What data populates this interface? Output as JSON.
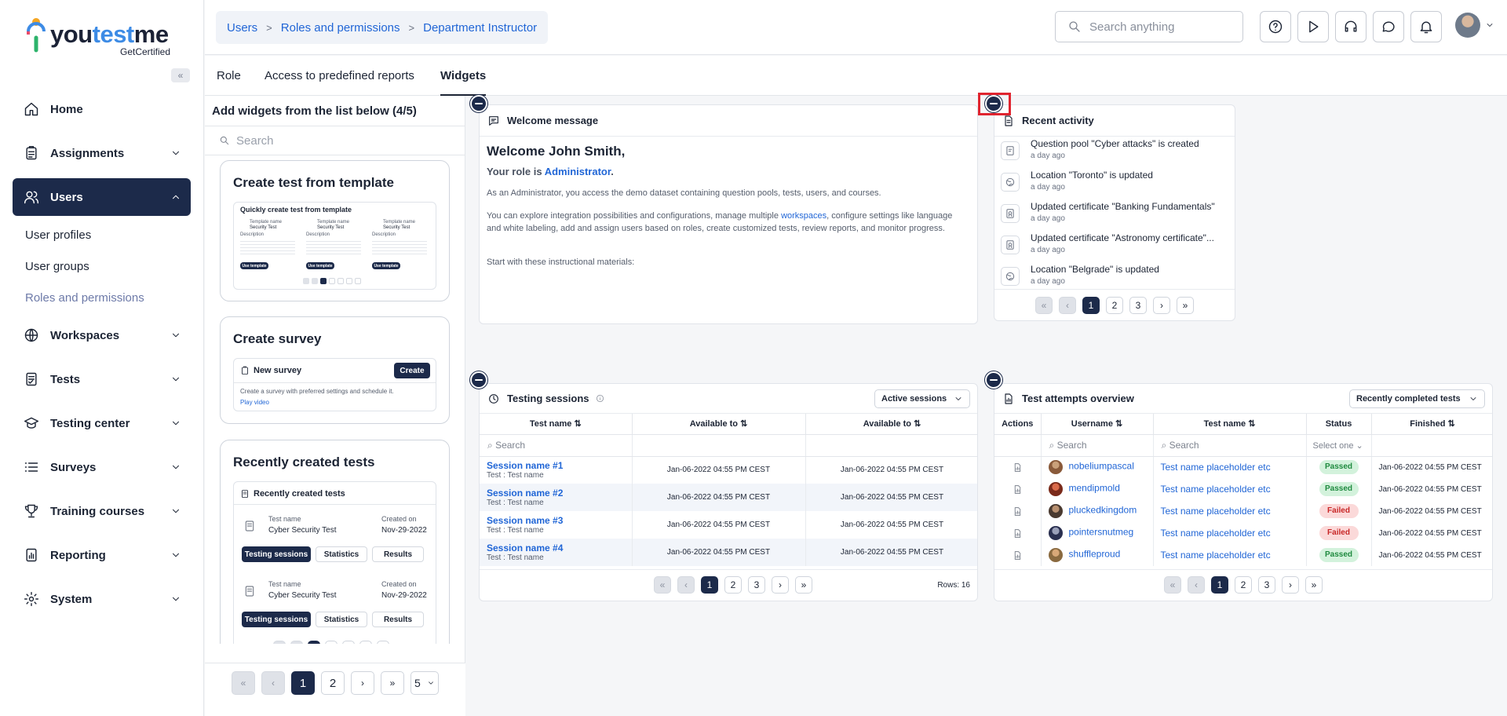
{
  "brand": {
    "name_a": "you",
    "name_b": "test",
    "name_c": "me",
    "tagline": "GetCertified"
  },
  "sidebar": {
    "items": [
      {
        "label": "Home",
        "icon": "home-icon"
      },
      {
        "label": "Assignments",
        "icon": "clipboard-icon"
      },
      {
        "label": "Users",
        "icon": "users-icon"
      },
      {
        "label": "Workspaces",
        "icon": "globe-icon"
      },
      {
        "label": "Tests",
        "icon": "test-icon"
      },
      {
        "label": "Testing center",
        "icon": "graduation-icon"
      },
      {
        "label": "Surveys",
        "icon": "list-icon"
      },
      {
        "label": "Training courses",
        "icon": "trophy-icon"
      },
      {
        "label": "Reporting",
        "icon": "report-icon"
      },
      {
        "label": "System",
        "icon": "gear-icon"
      }
    ],
    "users_sub": [
      "User profiles",
      "User groups",
      "Roles and permissions"
    ]
  },
  "breadcrumb": [
    "Users",
    "Roles and permissions",
    "Department Instructor"
  ],
  "search": {
    "placeholder": "Search anything"
  },
  "tabs": [
    "Role",
    "Access to predefined reports",
    "Widgets"
  ],
  "panel": {
    "title": "Add widgets from the list below (4/5)",
    "search_placeholder": "Search",
    "cards": {
      "template": {
        "title": "Create test from template",
        "inner_title": "Quickly create test from template",
        "col_label": "Template name",
        "col_value": "Security Test",
        "desc": "Description",
        "btn": "Use template"
      },
      "survey": {
        "title": "Create survey",
        "inner_title": "New survey",
        "btn": "Create",
        "desc": "Create a survey with preferred settings and schedule it.",
        "link": "Play video"
      },
      "recent": {
        "title": "Recently created tests",
        "inner_title": "Recently created tests",
        "rows": [
          {
            "name_label": "Test name",
            "name": "Cyber Security Test",
            "created_label": "Created on",
            "created": "Nov-29-2022"
          },
          {
            "name_label": "Test name",
            "name": "Cyber Security Test",
            "created_label": "Created on",
            "created": "Nov-29-2022"
          }
        ],
        "buttons": [
          "Testing sessions",
          "Statistics",
          "Results"
        ]
      }
    },
    "pager": {
      "pages": [
        "1",
        "2"
      ],
      "per_page": "5"
    }
  },
  "welcome": {
    "title": "Welcome message",
    "greeting": "Welcome John Smith,",
    "role_prefix": "Your role is ",
    "role": "Administrator",
    "p1": "As an Administrator, you access the demo dataset containing question pools, tests, users, and courses.",
    "p2a": "You can explore integration possibilities and configurations, manage multiple ",
    "p2link": "workspaces",
    "p2b": ", configure settings like language and white labeling, add and assign users based on roles, create customized tests, review reports, and monitor progress.",
    "p3": "Start with these instructional materials:"
  },
  "activity": {
    "title": "Recent activity",
    "items": [
      {
        "text": "Question pool \"Cyber attacks\" is created",
        "time": "a day ago",
        "icon": "question-pool-icon"
      },
      {
        "text": "Location \"Toronto\" is updated",
        "time": "a day ago",
        "icon": "location-icon"
      },
      {
        "text": "Updated certificate \"Banking Fundamentals\"",
        "time": "a day ago",
        "icon": "certificate-icon"
      },
      {
        "text": "Updated certificate \"Astronomy certificate\"...",
        "time": "a day ago",
        "icon": "certificate-icon"
      },
      {
        "text": "Location \"Belgrade\" is updated",
        "time": "a day ago",
        "icon": "location-icon"
      }
    ],
    "pages": [
      "1",
      "2",
      "3"
    ]
  },
  "sessions": {
    "title": "Testing sessions",
    "dropdown": "Active sessions",
    "columns": [
      "Test name",
      "Available to",
      "Available to"
    ],
    "search_placeholder": "Search",
    "rows": [
      {
        "name": "Session name #1",
        "sub": "Test : Test name",
        "a": "Jan-06-2022 04:55 PM CEST",
        "b": "Jan-06-2022 04:55 PM CEST"
      },
      {
        "name": "Session name #2",
        "sub": "Test : Test name",
        "a": "Jan-06-2022 04:55 PM CEST",
        "b": "Jan-06-2022 04:55 PM CEST"
      },
      {
        "name": "Session name #3",
        "sub": "Test : Test name",
        "a": "Jan-06-2022 04:55 PM CEST",
        "b": "Jan-06-2022 04:55 PM CEST"
      },
      {
        "name": "Session name #4",
        "sub": "Test : Test name",
        "a": "Jan-06-2022 04:55 PM CEST",
        "b": "Jan-06-2022 04:55 PM CEST"
      }
    ],
    "pages": [
      "1",
      "2",
      "3"
    ],
    "rows_label": "Rows: 16"
  },
  "attempts": {
    "title": "Test attempts overview",
    "dropdown": "Recently completed tests",
    "columns": [
      "Actions",
      "Username",
      "Test name",
      "Status",
      "Finished"
    ],
    "search_placeholder": "Search",
    "status_placeholder": "Select one",
    "rows": [
      {
        "user": "nobeliumpascal",
        "test": "Test name placeholder etc",
        "status": "Passed",
        "finished": "Jan-06-2022 04:55 PM CEST"
      },
      {
        "user": "mendipmold",
        "test": "Test name placeholder etc",
        "status": "Passed",
        "finished": "Jan-06-2022 04:55 PM CEST"
      },
      {
        "user": "pluckedkingdom",
        "test": "Test name placeholder etc",
        "status": "Failed",
        "finished": "Jan-06-2022 04:55 PM CEST"
      },
      {
        "user": "pointersnutmeg",
        "test": "Test name placeholder etc",
        "status": "Failed",
        "finished": "Jan-06-2022 04:55 PM CEST"
      },
      {
        "user": "shuffleproud",
        "test": "Test name placeholder etc",
        "status": "Passed",
        "finished": "Jan-06-2022 04:55 PM CEST"
      }
    ],
    "pages": [
      "1",
      "2",
      "3"
    ]
  },
  "colors": {
    "primary": "#1c2a4a",
    "link": "#2166d6",
    "highlight": "#e0242f"
  }
}
